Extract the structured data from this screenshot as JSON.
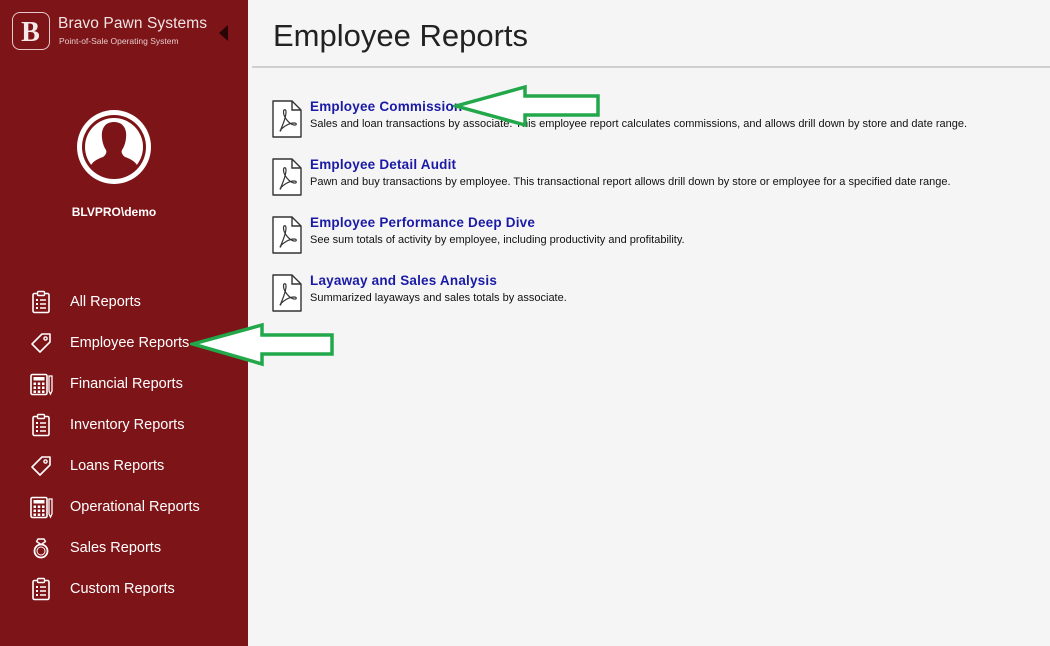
{
  "brand": {
    "name": "Bravo Pawn Systems",
    "tagline": "Point-of-Sale Operating System",
    "logo_letter": "B"
  },
  "user": {
    "name": "BLVPRO\\demo"
  },
  "sidebar": {
    "items": [
      {
        "label": "All Reports",
        "icon": "clipboard-list-icon"
      },
      {
        "label": "Employee Reports",
        "icon": "tag-icon"
      },
      {
        "label": "Financial Reports",
        "icon": "calculator-icon"
      },
      {
        "label": "Inventory Reports",
        "icon": "clipboard-list-icon"
      },
      {
        "label": "Loans Reports",
        "icon": "tag-icon"
      },
      {
        "label": "Operational Reports",
        "icon": "calculator-icon"
      },
      {
        "label": "Sales Reports",
        "icon": "ring-icon"
      },
      {
        "label": "Custom Reports",
        "icon": "clipboard-list-icon"
      }
    ]
  },
  "main": {
    "title": "Employee Reports",
    "reports": [
      {
        "title": "Employee Commission",
        "description": "Sales and loan transactions by associate. This employee report calculates commissions, and allows drill down by store and date range.",
        "icon": "pdf-icon"
      },
      {
        "title": "Employee Detail Audit",
        "description": "Pawn and buy transactions by employee. This transactional report allows drill down by store or employee for a specified date range.",
        "icon": "pdf-icon"
      },
      {
        "title": "Employee Performance Deep Dive",
        "description": "See sum totals of activity by employee, including productivity and profitability.",
        "icon": "pdf-icon"
      },
      {
        "title": "Layaway and Sales Analysis",
        "description": "Summarized layaways and sales totals by associate.",
        "icon": "pdf-icon"
      }
    ]
  },
  "colors": {
    "sidebar_bg": "#7d1418",
    "link": "#1a1aa6",
    "annotation_arrow": "#22a84a"
  }
}
